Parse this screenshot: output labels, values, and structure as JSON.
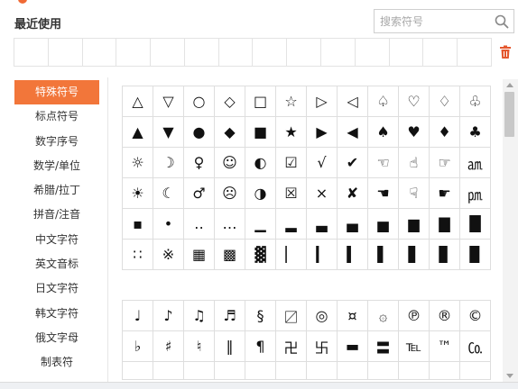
{
  "recent": {
    "title": "最近使用",
    "cell_count": 14
  },
  "search": {
    "placeholder": "搜索符号"
  },
  "sidebar": {
    "active_index": 0,
    "items": [
      {
        "label": "特殊符号"
      },
      {
        "label": "标点符号"
      },
      {
        "label": "数字序号"
      },
      {
        "label": "数学/单位"
      },
      {
        "label": "希腊/拉丁"
      },
      {
        "label": "拼音/注音"
      },
      {
        "label": "中文字符"
      },
      {
        "label": "英文音标"
      },
      {
        "label": "日文字符"
      },
      {
        "label": "韩文字符"
      },
      {
        "label": "俄文字母"
      },
      {
        "label": "制表符"
      }
    ]
  },
  "symbols_grid1": [
    "△",
    "▽",
    "○",
    "◇",
    "□",
    "☆",
    "▷",
    "◁",
    "♤",
    "♡",
    "♢",
    "♧",
    "▲",
    "▼",
    "●",
    "◆",
    "■",
    "★",
    "▶",
    "◀",
    "♠",
    "♥",
    "♦",
    "♣",
    "☼",
    "☽",
    "♀",
    "☺",
    "◐",
    "☑",
    "√",
    "✔",
    "☜",
    "☝",
    "☞",
    "㏂",
    "☀",
    "☾",
    "♂",
    "☹",
    "◑",
    "☒",
    "×",
    "✘",
    "☚",
    "☟",
    "☛",
    "㏘",
    "▪",
    "•",
    "‥",
    "…",
    "▁",
    "▂",
    "▃",
    "▄",
    "▅",
    "▆",
    "▇",
    "█",
    "∷",
    "※",
    "▦",
    "▩",
    "▓",
    "▏",
    "▎",
    "▍",
    "▌",
    "▋",
    "▊",
    "▉"
  ],
  "symbols_grid2": [
    "♩",
    "♪",
    "♫",
    "♬",
    "§",
    "〼",
    "◎",
    "¤",
    "۞",
    "℗",
    "®",
    "©",
    "♭",
    "♯",
    "♮",
    "‖",
    "¶",
    "卍",
    "卐",
    "▬",
    "〓",
    "℡",
    "™",
    "㏇",
    "",
    "",
    "",
    "",
    "",
    "",
    "",
    "",
    "",
    "",
    "",
    ""
  ],
  "icons": {
    "search": "search-icon",
    "trash": "trash-icon"
  },
  "colors": {
    "accent": "#f2763a",
    "grid_border": "#dedede",
    "trash": "#e4572e"
  }
}
